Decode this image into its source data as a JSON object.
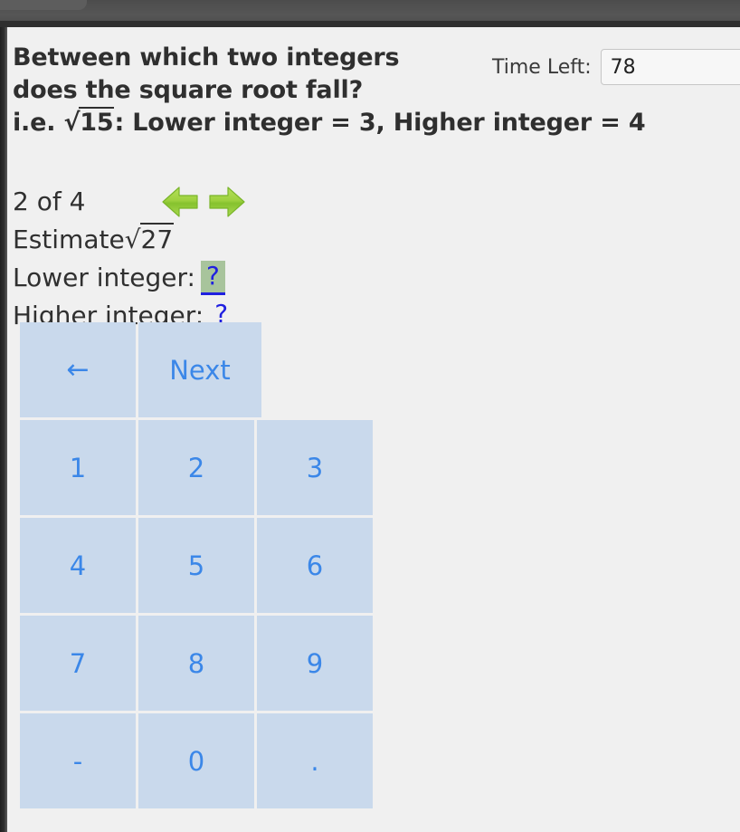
{
  "chrome": {
    "tab_icon": "browser-tab-shape"
  },
  "quiz": {
    "instructions": {
      "line1": "Between which two integers",
      "line2": "does the square root fall?",
      "line3_prefix": "i.e. ",
      "line3_radicand": "15",
      "line3_suffix": ": Lower integer = 3, Higher integer = 4",
      "radical_sign": "√"
    },
    "timer": {
      "label": "Time Left:",
      "value": "78"
    },
    "progress": "2 of 4",
    "nav": {
      "prev_icon": "green-left-arrow-icon",
      "next_icon": "green-right-arrow-icon"
    },
    "task": {
      "prefix": "Estimate ",
      "radicand": "27"
    },
    "fields": [
      {
        "label": "Lower integer:",
        "value": "?",
        "active": true
      },
      {
        "label": "Higher integer:",
        "value": "?",
        "active": false
      }
    ]
  },
  "keypad": {
    "row1": [
      {
        "label": "←",
        "name": "backspace"
      },
      {
        "label": "Next",
        "name": "next"
      }
    ],
    "row2": [
      "1",
      "2",
      "3"
    ],
    "row3": [
      "4",
      "5",
      "6"
    ],
    "row4": [
      "7",
      "8",
      "9"
    ],
    "row5": [
      "-",
      "0",
      "."
    ]
  },
  "colors": {
    "key_fill": "#c9d9ec",
    "key_text": "#3b87e8",
    "active_highlight": "#a8c49c",
    "link_blue": "#2020e0",
    "arrow_green": "#8dc63f",
    "page_bg": "#f0f0f0"
  }
}
